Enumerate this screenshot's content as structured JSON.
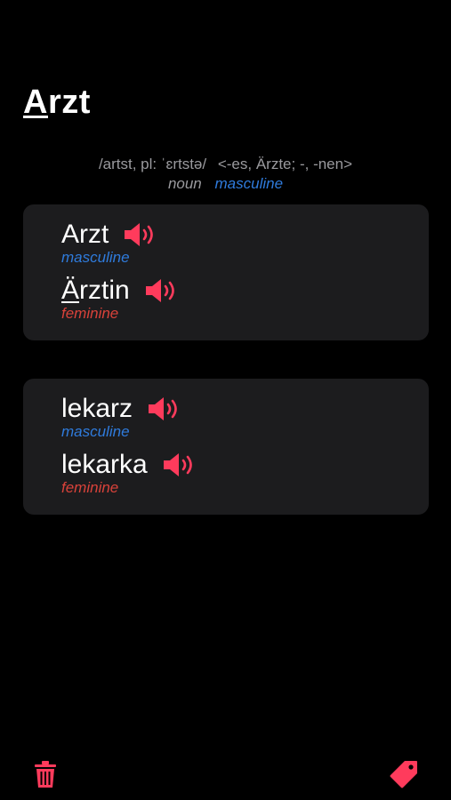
{
  "header": {
    "title_accent_letter": "A",
    "title_rest": "rzt",
    "pronunciation": "/artst, pl: ˈɛrtstə/",
    "inflection": "<-es, Ärzte; -, -nen>",
    "part_of_speech": "noun",
    "gender": "masculine"
  },
  "cards": [
    {
      "entries": [
        {
          "word_prefix": "",
          "word_accent": "",
          "word_rest": "Arzt",
          "gender": "masculine"
        },
        {
          "word_prefix": "",
          "word_accent": "Ä",
          "word_rest": "rztin",
          "gender": "feminine"
        }
      ]
    },
    {
      "entries": [
        {
          "word_prefix": "",
          "word_accent": "",
          "word_rest": "lekarz",
          "gender": "masculine"
        },
        {
          "word_prefix": "",
          "word_accent": "",
          "word_rest": "lekarka",
          "gender": "feminine"
        }
      ]
    }
  ],
  "icons": {
    "speaker": "speaker-icon",
    "trash": "trash-icon",
    "tag": "tag-icon"
  },
  "colors": {
    "accent_pink": "#ff3b5c",
    "masculine_blue": "#2f7bdc",
    "feminine_red": "#d9423a",
    "card_bg": "#1c1c1e"
  }
}
